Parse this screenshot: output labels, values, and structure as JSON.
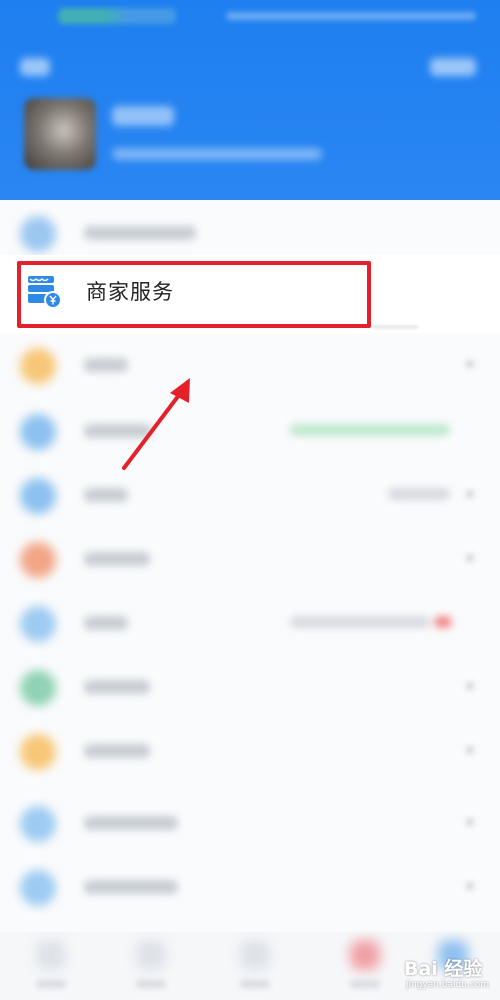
{
  "merchant_service": {
    "label": "商家服务",
    "icon": "storefront-yen-icon",
    "icon_color": "#2f8ae6"
  },
  "annotation": {
    "highlight_color": "#e4202a",
    "arrow": "pointer-arrow"
  },
  "theme": {
    "header_color": "#1e7ff0"
  },
  "watermark": {
    "text": "Bai 经验",
    "sub": "jingyan.baidu.com"
  }
}
